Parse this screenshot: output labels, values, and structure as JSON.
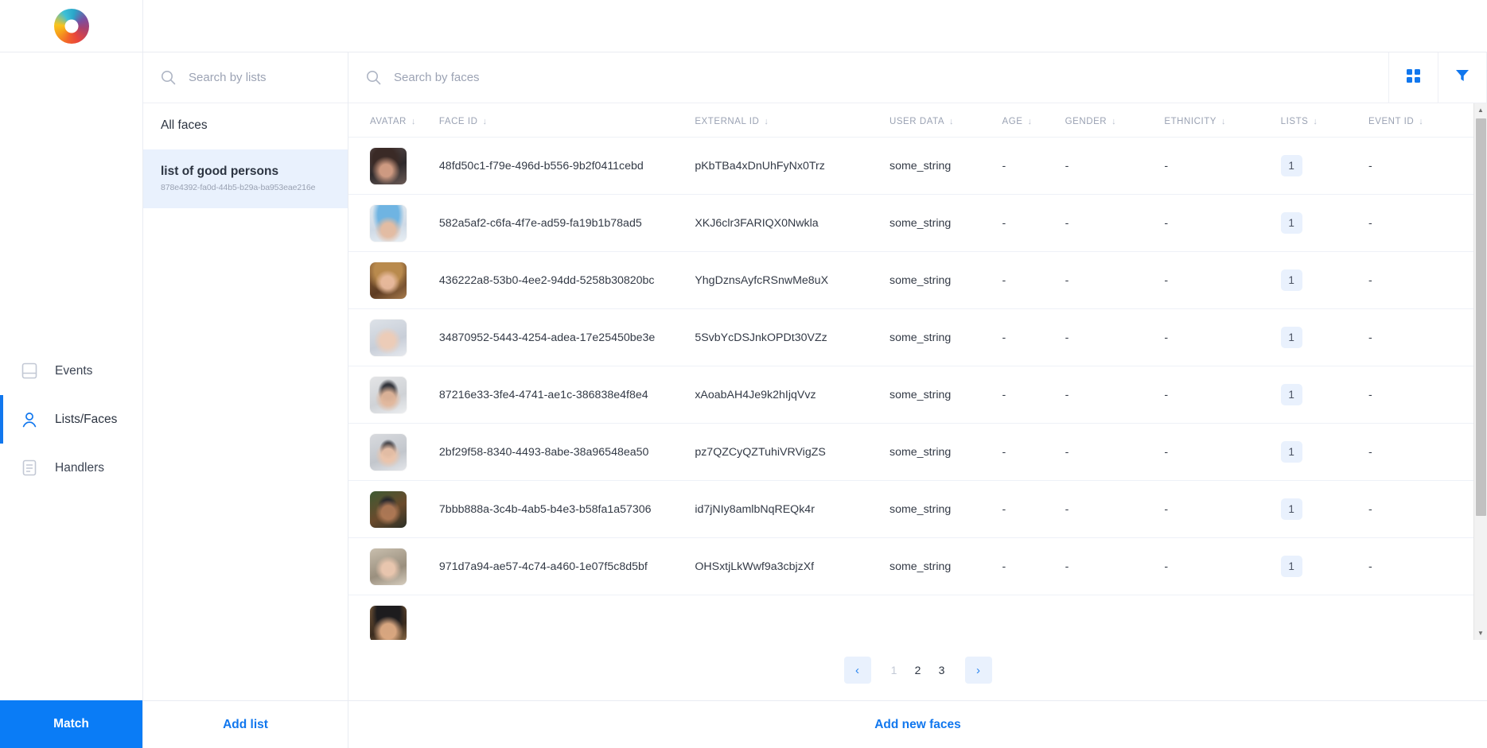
{
  "brand": {
    "logo_icon": "ring-logo"
  },
  "nav": {
    "items": [
      {
        "label": "Events",
        "icon": "card-icon",
        "active": false
      },
      {
        "label": "Lists/Faces",
        "icon": "person-icon",
        "active": true
      },
      {
        "label": "Handlers",
        "icon": "document-icon",
        "active": false
      }
    ],
    "match_button": "Match"
  },
  "lists_panel": {
    "search_placeholder": "Search by lists",
    "search_value": "",
    "search_icon": "search-icon",
    "items": [
      {
        "name": "All faces",
        "uuid": "",
        "selected": false
      },
      {
        "name": "list of good persons",
        "uuid": "878e4392-fa0d-44b5-b29a-ba953eae216e",
        "selected": true
      }
    ],
    "add_list_label": "Add list"
  },
  "main": {
    "search_placeholder": "Search by faces",
    "search_value": "",
    "search_icon": "search-icon",
    "actions": [
      {
        "name": "grid-view-icon"
      },
      {
        "name": "filter-icon"
      }
    ],
    "add_new_faces_label": "Add new faces",
    "sort_glyph": "↓",
    "columns": [
      "AVATAR",
      "FACE ID",
      "EXTERNAL ID",
      "USER DATA",
      "AGE",
      "GENDER",
      "ETHNICITY",
      "LISTS",
      "EVENT ID"
    ],
    "rows": [
      {
        "avatar": "av1",
        "face_id": "48fd50c1-f79e-496d-b556-9b2f0411cebd",
        "external_id": "pKbTBa4xDnUhFyNx0Trz",
        "user_data": "some_string",
        "age": "-",
        "gender": "-",
        "ethnicity": "-",
        "lists": "1",
        "event_id": "-"
      },
      {
        "avatar": "av2",
        "face_id": "582a5af2-c6fa-4f7e-ad59-fa19b1b78ad5",
        "external_id": "XKJ6clr3FARIQX0Nwkla",
        "user_data": "some_string",
        "age": "-",
        "gender": "-",
        "ethnicity": "-",
        "lists": "1",
        "event_id": "-"
      },
      {
        "avatar": "av3",
        "face_id": "436222a8-53b0-4ee2-94dd-5258b30820bc",
        "external_id": "YhgDznsAyfcRSnwMe8uX",
        "user_data": "some_string",
        "age": "-",
        "gender": "-",
        "ethnicity": "-",
        "lists": "1",
        "event_id": "-"
      },
      {
        "avatar": "av4",
        "face_id": "34870952-5443-4254-adea-17e25450be3e",
        "external_id": "5SvbYcDSJnkOPDt30VZz",
        "user_data": "some_string",
        "age": "-",
        "gender": "-",
        "ethnicity": "-",
        "lists": "1",
        "event_id": "-"
      },
      {
        "avatar": "av5",
        "face_id": "87216e33-3fe4-4741-ae1c-386838e4f8e4",
        "external_id": "xAoabAH4Je9k2hIjqVvz",
        "user_data": "some_string",
        "age": "-",
        "gender": "-",
        "ethnicity": "-",
        "lists": "1",
        "event_id": "-"
      },
      {
        "avatar": "av6",
        "face_id": "2bf29f58-8340-4493-8abe-38a96548ea50",
        "external_id": "pz7QZCyQZTuhiVRVigZS",
        "user_data": "some_string",
        "age": "-",
        "gender": "-",
        "ethnicity": "-",
        "lists": "1",
        "event_id": "-"
      },
      {
        "avatar": "av7",
        "face_id": "7bbb888a-3c4b-4ab5-b4e3-b58fa1a57306",
        "external_id": "id7jNIy8amlbNqREQk4r",
        "user_data": "some_string",
        "age": "-",
        "gender": "-",
        "ethnicity": "-",
        "lists": "1",
        "event_id": "-"
      },
      {
        "avatar": "av8",
        "face_id": "971d7a94-ae57-4c74-a460-1e07f5c8d5bf",
        "external_id": "OHSxtjLkWwf9a3cbjzXf",
        "user_data": "some_string",
        "age": "-",
        "gender": "-",
        "ethnicity": "-",
        "lists": "1",
        "event_id": "-"
      },
      {
        "avatar": "av9",
        "face_id": "",
        "external_id": "",
        "user_data": "",
        "age": "",
        "gender": "",
        "ethnicity": "",
        "lists": "",
        "event_id": ""
      }
    ],
    "pagination": {
      "prev_icon": "chevron-left-icon",
      "next_icon": "chevron-right-icon",
      "pages": [
        "1",
        "2",
        "3"
      ],
      "current": "1"
    }
  },
  "colors": {
    "accent": "#0a7cf6",
    "accent_soft": "#e9f1fd",
    "text": "#2c3441",
    "muted": "#9aa2b3"
  }
}
